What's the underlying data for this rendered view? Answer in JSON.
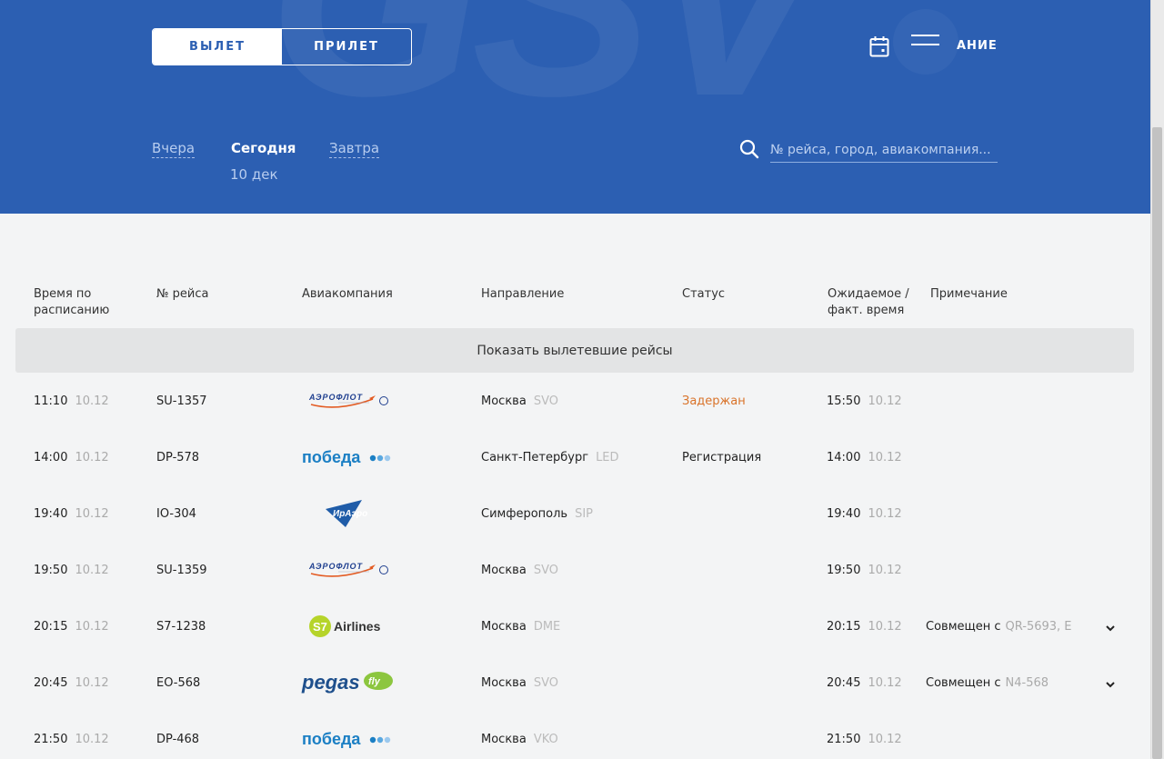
{
  "header": {
    "watermark": "GSV",
    "direction_tabs": [
      {
        "label": "ВЫЛЕТ",
        "active": true
      },
      {
        "label": "ПРИЛЕТ",
        "active": false
      }
    ],
    "schedule_label": "АНИЕ",
    "days": {
      "yesterday": "Вчера",
      "today": "Сегодня",
      "tomorrow": "Завтра",
      "today_date": "10 дек"
    },
    "search": {
      "placeholder": "№ рейса, город, авиакомпания..."
    },
    "accent_color": "#2c5fb2"
  },
  "table": {
    "columns": {
      "scheduled": "Время по расписанию",
      "flight": "№ рейса",
      "airline": "Авиакомпания",
      "destination": "Направление",
      "status": "Статус",
      "expected": "Ожидаемое / факт. время",
      "note": "Примечание"
    },
    "show_departed": "Показать вылетевшие рейсы",
    "rows": [
      {
        "time": "11:10",
        "date": "10.12",
        "flight": "SU-1357",
        "airline_logo": "aeroflot-logo",
        "airline_text": "АЭРОФЛОТ",
        "city": "Москва",
        "code": "SVO",
        "status": "Задержан",
        "exp_time": "15:50",
        "exp_date": "10.12",
        "note": "",
        "note_code": ""
      },
      {
        "time": "14:00",
        "date": "10.12",
        "flight": "DP-578",
        "airline_logo": "pobeda-logo",
        "airline_text": "победа",
        "city": "Санкт-Петербург",
        "code": "LED",
        "status": "Регистрация",
        "exp_time": "14:00",
        "exp_date": "10.12",
        "note": "",
        "note_code": ""
      },
      {
        "time": "19:40",
        "date": "10.12",
        "flight": "IO-304",
        "airline_logo": "iraero-logo",
        "airline_text": "ИрАэро",
        "city": "Симферополь",
        "code": "SIP",
        "status": "",
        "exp_time": "19:40",
        "exp_date": "10.12",
        "note": "",
        "note_code": ""
      },
      {
        "time": "19:50",
        "date": "10.12",
        "flight": "SU-1359",
        "airline_logo": "aeroflot-logo",
        "airline_text": "АЭРОФЛОТ",
        "city": "Москва",
        "code": "SVO",
        "status": "",
        "exp_time": "19:50",
        "exp_date": "10.12",
        "note": "",
        "note_code": ""
      },
      {
        "time": "20:15",
        "date": "10.12",
        "flight": "S7-1238",
        "airline_logo": "s7-logo",
        "airline_text": "Airlines",
        "city": "Москва",
        "code": "DME",
        "status": "",
        "exp_time": "20:15",
        "exp_date": "10.12",
        "note": "Совмещен с",
        "note_code": "QR-5693, E"
      },
      {
        "time": "20:45",
        "date": "10.12",
        "flight": "EO-568",
        "airline_logo": "pegas-logo",
        "airline_text": "pegas",
        "city": "Москва",
        "code": "SVO",
        "status": "",
        "exp_time": "20:45",
        "exp_date": "10.12",
        "note": "Совмещен с",
        "note_code": "N4-568"
      },
      {
        "time": "21:50",
        "date": "10.12",
        "flight": "DP-468",
        "airline_logo": "pobeda-logo",
        "airline_text": "победа",
        "city": "Москва",
        "code": "VKO",
        "status": "",
        "exp_time": "21:50",
        "exp_date": "10.12",
        "note": "",
        "note_code": ""
      }
    ]
  }
}
